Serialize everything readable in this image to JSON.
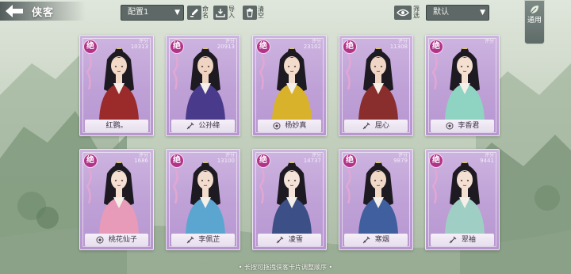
{
  "header": {
    "title": "侠客",
    "preset_label": "配置1",
    "rename_label": "命名",
    "import_label": "导入",
    "clear_label": "清空",
    "filter_label": "筛选",
    "sort_label": "默认",
    "common_tab_label": "通用"
  },
  "cards": [
    {
      "name": "红鹦。",
      "grade": "绝",
      "score_label": "评分",
      "score": "10313",
      "sect_icon": "none",
      "robe": "#9b2a2a",
      "skin": "#f2d9c8"
    },
    {
      "name": "公孙绛",
      "grade": "绝",
      "score_label": "评分",
      "score": "20913",
      "sect_icon": "sword-icon",
      "robe": "#4a3a8c",
      "skin": "#f0d4c2"
    },
    {
      "name": "杨妙真",
      "grade": "绝",
      "score_label": "评分",
      "score": "23102",
      "sect_icon": "sect-emblem-icon",
      "robe": "#d8b22a",
      "skin": "#f3dccb"
    },
    {
      "name": "屈心",
      "grade": "绝",
      "score_label": "评分",
      "score": "11308",
      "sect_icon": "sword-icon",
      "robe": "#8a2d2d",
      "skin": "#f0d6c5"
    },
    {
      "name": "李香君",
      "grade": "绝",
      "score_label": "评分",
      "score": "",
      "sect_icon": "sect-emblem-icon",
      "robe": "#8fd3c2",
      "skin": "#f4dfd0"
    },
    {
      "name": "桃花仙子",
      "grade": "绝",
      "score_label": "评分",
      "score": "1686",
      "sect_icon": "sect-emblem-icon",
      "robe": "#e79bb8",
      "skin": "#f5e0d2"
    },
    {
      "name": "李佩芷",
      "grade": "绝",
      "score_label": "评分",
      "score": "13100",
      "sect_icon": "sword-icon",
      "robe": "#5aa6d0",
      "skin": "#f2dccd"
    },
    {
      "name": "凌雪",
      "grade": "绝",
      "score_label": "评分",
      "score": "14737",
      "sect_icon": "sword-icon",
      "robe": "#3c4f86",
      "skin": "#f3e3d8"
    },
    {
      "name": "寒烟",
      "grade": "绝",
      "score_label": "评分",
      "score": "9879",
      "sect_icon": "sword-icon",
      "robe": "#3f5f9e",
      "skin": "#f1d9c8"
    },
    {
      "name": "翠袖",
      "grade": "绝",
      "score_label": "评分",
      "score": "9441",
      "sect_icon": "sword-icon",
      "robe": "#9fcfc4",
      "skin": "#f4e0d2"
    }
  ],
  "footer": {
    "hint": "长按可拖拽侠客卡片调整顺序"
  },
  "colors": {
    "card_bg": "#c5a8dc",
    "grade_badge": "#b2338a",
    "toolbar": "#5e6866"
  }
}
